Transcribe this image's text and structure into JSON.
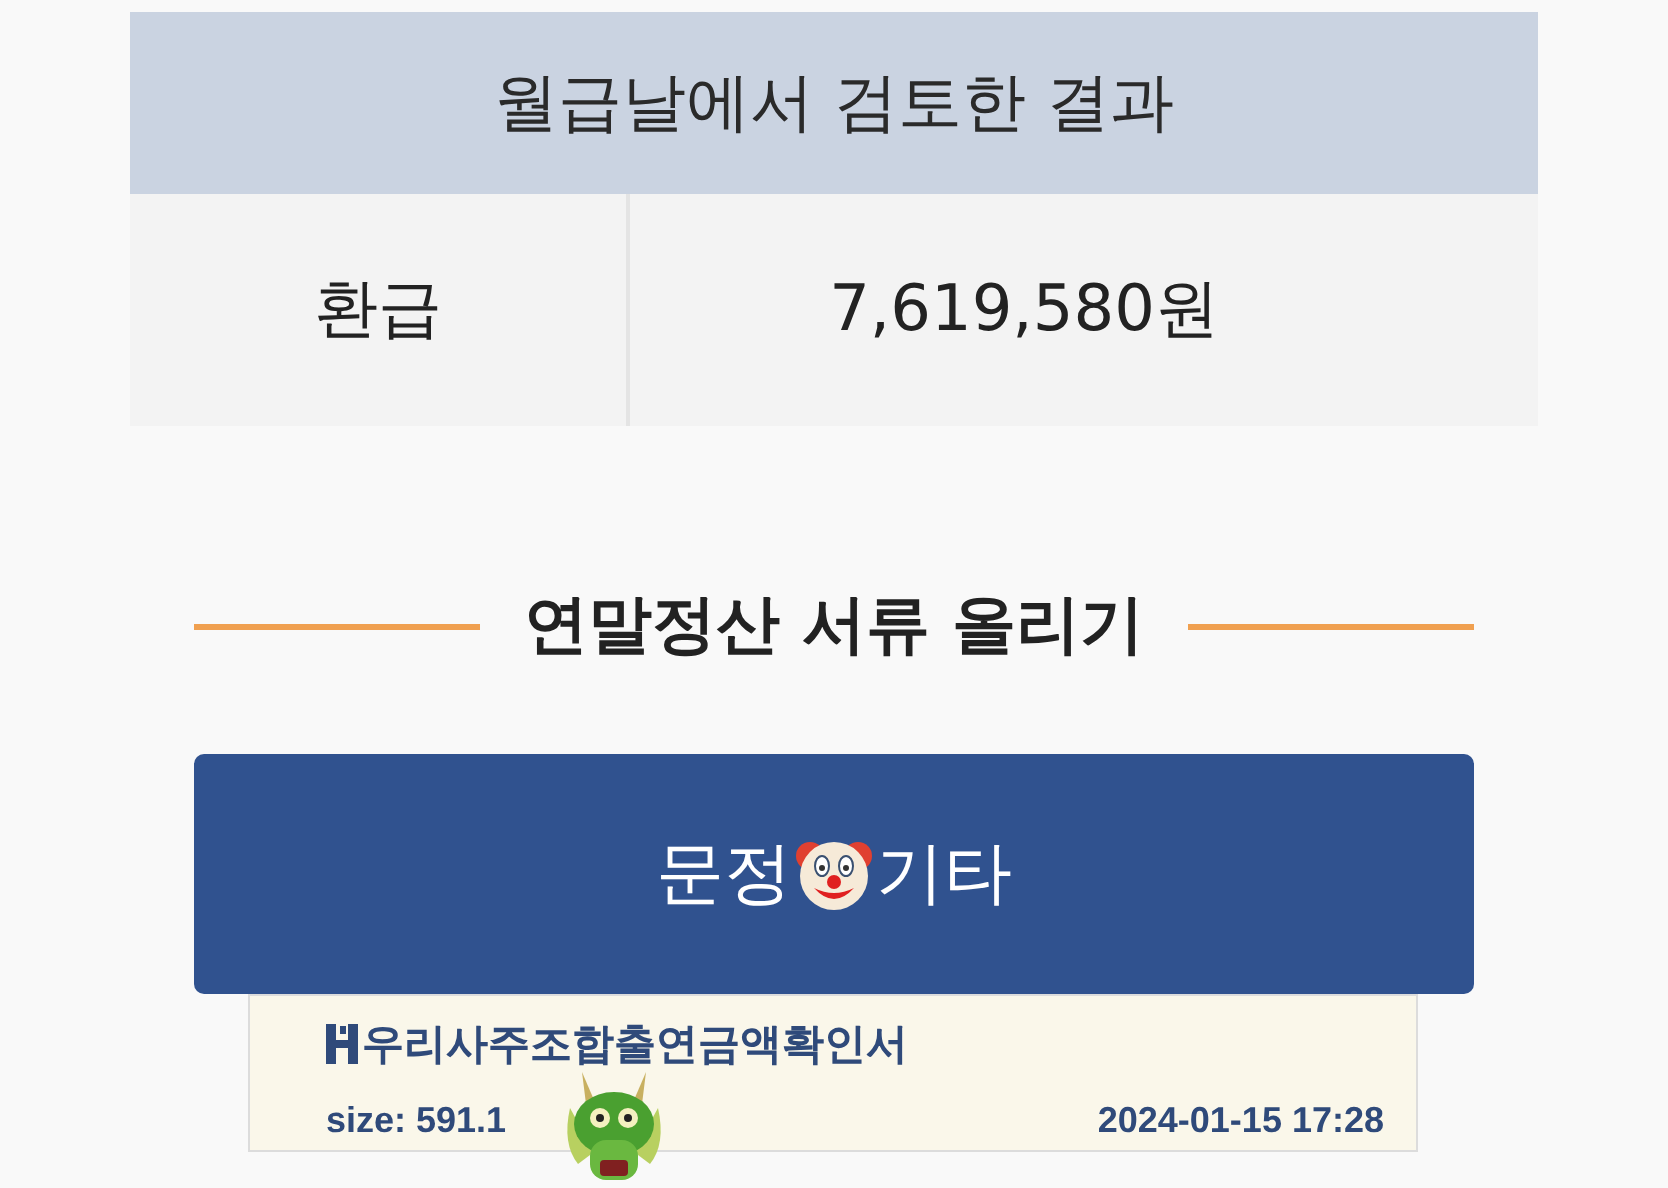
{
  "result_table": {
    "title": "월급날에서 검토한 결과",
    "rows": [
      {
        "label": "환급",
        "value": "7,619,580원"
      }
    ]
  },
  "section_heading": "연말정산 서류 올리기",
  "upload_button": {
    "label_parts": [
      "문정",
      "기타"
    ]
  },
  "files": [
    {
      "name": "우리사주조합출연금액확인서",
      "size": "size: 591.1",
      "date": "2024-01-15 17:28"
    }
  ]
}
